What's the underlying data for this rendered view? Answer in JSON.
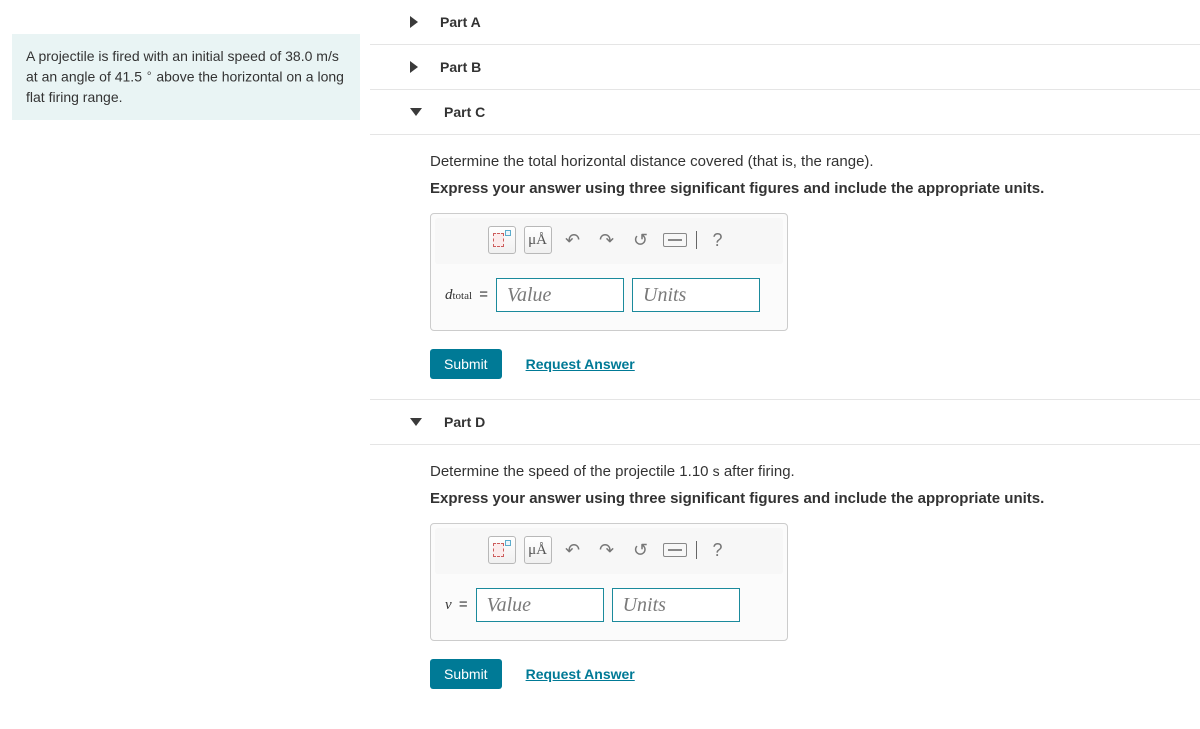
{
  "problem": {
    "text_pre": "A projectile is fired with an initial speed of 38.0 ",
    "units1": "m/s",
    "text_mid": " at an angle of 41.5 ",
    "deg_symbol": "∘",
    "text_post": " above the horizontal on a long flat firing range."
  },
  "parts": {
    "a": {
      "label": "Part A"
    },
    "b": {
      "label": "Part B"
    },
    "c": {
      "label": "Part C",
      "question": "Determine the total horizontal distance covered (that is, the range).",
      "instruction": "Express your answer using three significant figures and include the appropriate units.",
      "var_symbol": "d",
      "var_sub": "total",
      "value_ph": "Value",
      "units_ph": "Units",
      "submit": "Submit",
      "request": "Request Answer"
    },
    "d": {
      "label": "Part D",
      "question_pre": "Determine the speed of the projectile 1.10 ",
      "question_unit": "s",
      "question_post": " after firing.",
      "instruction": "Express your answer using three significant figures and include the appropriate units.",
      "var_symbol": "v",
      "value_ph": "Value",
      "units_ph": "Units",
      "submit": "Submit",
      "request": "Request Answer"
    }
  },
  "toolbar": {
    "mu": "μÅ",
    "help": "?"
  }
}
